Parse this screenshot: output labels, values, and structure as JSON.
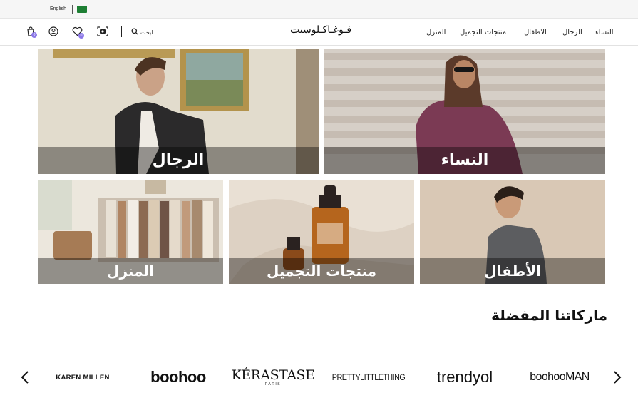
{
  "topbar": {
    "language": "English",
    "flag_icon": "saudi-flag-icon"
  },
  "header": {
    "logo": "فـوغـاكـلوسيت",
    "search_label": "ابحث",
    "cart_badge": "0",
    "wishlist_badge": "0",
    "nav": [
      "النساء",
      "الرجال",
      "الاطفال",
      "منتجات التجميل",
      "المنزل"
    ],
    "icons": [
      "cart-icon",
      "account-icon",
      "wishlist-icon",
      "camera-search-icon",
      "search-icon"
    ]
  },
  "categories": [
    {
      "label": "الرجال",
      "bg": "#cfc6b2"
    },
    {
      "label": "النساء",
      "bg": "#c8bdb2"
    },
    {
      "label": "المنزل",
      "bg": "#d8d2c6"
    },
    {
      "label": "منتجات التجميل",
      "bg": "#e2d8cc"
    },
    {
      "label": "الأطفال",
      "bg": "#d6c4b0"
    }
  ],
  "brands_section": {
    "title": "ماركاتنا المفضلة",
    "brands": [
      "KAREN MILLEN",
      "boohoo",
      "KÉRASTASE",
      "PARIS",
      "PRETTYLITTLETHING",
      "trendyol",
      "boohooMAN"
    ]
  },
  "colors": {
    "accent": "#8c78e8",
    "flag": "#1e7f34"
  }
}
